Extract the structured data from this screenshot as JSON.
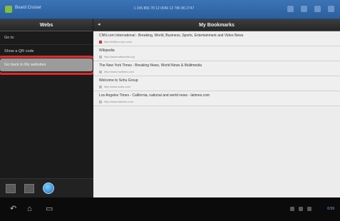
{
  "statusbar": {
    "app_label": "Board Cruiser",
    "center_info": "1 245 866 78 12 0040 12 786 86 2747",
    "icons": [
      "wifi-icon",
      "battery-icon",
      "signal-icon",
      "settings-icon"
    ]
  },
  "left_panel": {
    "title": "Webs",
    "items": [
      {
        "label": "Go to",
        "selected": false
      },
      {
        "label": "Show a QR code",
        "selected": false
      },
      {
        "label": "Go back to My websites",
        "selected": true
      }
    ],
    "highlight_color": "#e12b2b"
  },
  "right_panel": {
    "title": "My Bookmarks",
    "bookmarks": [
      {
        "title": "CNN.com International - Breaking, World, Business, Sports, Entertainment and Video News",
        "url": "http://edition.cnn.com/"
      },
      {
        "title": "Wikipedia",
        "url": "http://www.wikipedia.org"
      },
      {
        "title": "The New York Times - Breaking News, World News & Multimedia",
        "url": "http://www.nytimes.com"
      },
      {
        "title": "Welcome to Sohu Group",
        "url": "http://www.sohu.com"
      },
      {
        "title": "Los Angeles Times - California, national and world news - latimes.com",
        "url": "http://www.latimes.com"
      }
    ]
  },
  "navbar": {
    "clock": "6:59",
    "buttons": [
      "back",
      "home",
      "recent-apps"
    ]
  }
}
